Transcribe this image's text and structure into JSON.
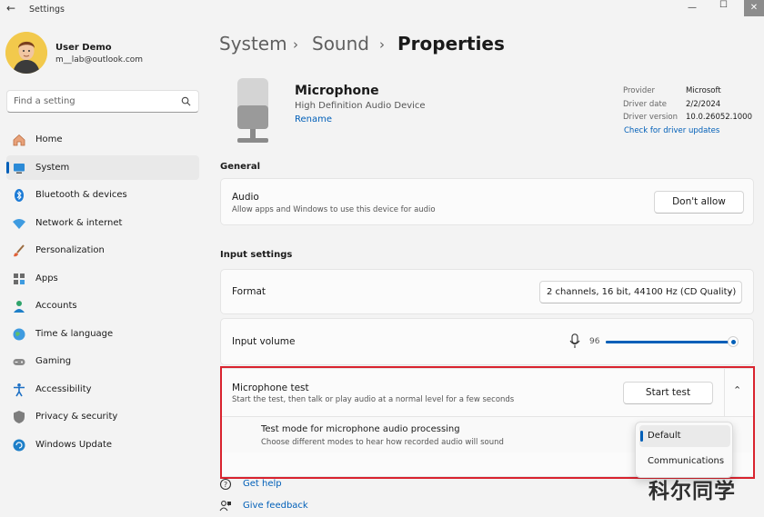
{
  "window": {
    "title": "Settings"
  },
  "user": {
    "name": "User Demo",
    "email": "m__lab@outlook.com"
  },
  "search": {
    "placeholder": "Find a setting"
  },
  "nav": [
    {
      "label": "Home",
      "icon": "home-icon"
    },
    {
      "label": "System",
      "icon": "system-icon",
      "active": true
    },
    {
      "label": "Bluetooth & devices",
      "icon": "bluetooth-icon"
    },
    {
      "label": "Network & internet",
      "icon": "network-icon"
    },
    {
      "label": "Personalization",
      "icon": "brush-icon"
    },
    {
      "label": "Apps",
      "icon": "apps-icon"
    },
    {
      "label": "Accounts",
      "icon": "accounts-icon"
    },
    {
      "label": "Time & language",
      "icon": "globe-icon"
    },
    {
      "label": "Gaming",
      "icon": "gamepad-icon"
    },
    {
      "label": "Accessibility",
      "icon": "accessibility-icon"
    },
    {
      "label": "Privacy & security",
      "icon": "shield-icon"
    },
    {
      "label": "Windows Update",
      "icon": "update-icon"
    }
  ],
  "breadcrumb": {
    "items": [
      "System",
      "Sound",
      "Properties"
    ]
  },
  "device": {
    "name": "Microphone",
    "description": "High Definition Audio Device",
    "rename_label": "Rename",
    "provider_label": "Provider",
    "provider": "Microsoft",
    "driver_date_label": "Driver date",
    "driver_date": "2/2/2024",
    "driver_version_label": "Driver version",
    "driver_version": "10.0.26052.1000",
    "driver_update_link": "Check for driver updates"
  },
  "general": {
    "title": "General",
    "audio_title": "Audio",
    "audio_desc": "Allow apps and Windows to use this device for audio",
    "audio_button": "Don't allow"
  },
  "input": {
    "title": "Input settings",
    "format_label": "Format",
    "format_value": "2 channels, 16 bit, 44100 Hz (CD Quality)",
    "volume_label": "Input volume",
    "volume_value": "96",
    "volume_level": 0.96,
    "mic_test_title": "Microphone test",
    "mic_test_desc": "Start the test, then talk or play audio at a normal level for a few seconds",
    "start_test_button": "Start test",
    "test_mode_title": "Test mode for microphone audio processing",
    "test_mode_desc": "Choose different modes to hear how recorded audio will sound",
    "test_mode_options": [
      "Default",
      "Communications"
    ],
    "test_mode_selected": "Default"
  },
  "help": {
    "get_help": "Get help",
    "give_feedback": "Give feedback"
  },
  "watermark": "科尔同学",
  "colors": {
    "accent": "#005fb8",
    "highlight": "#d9232e"
  }
}
